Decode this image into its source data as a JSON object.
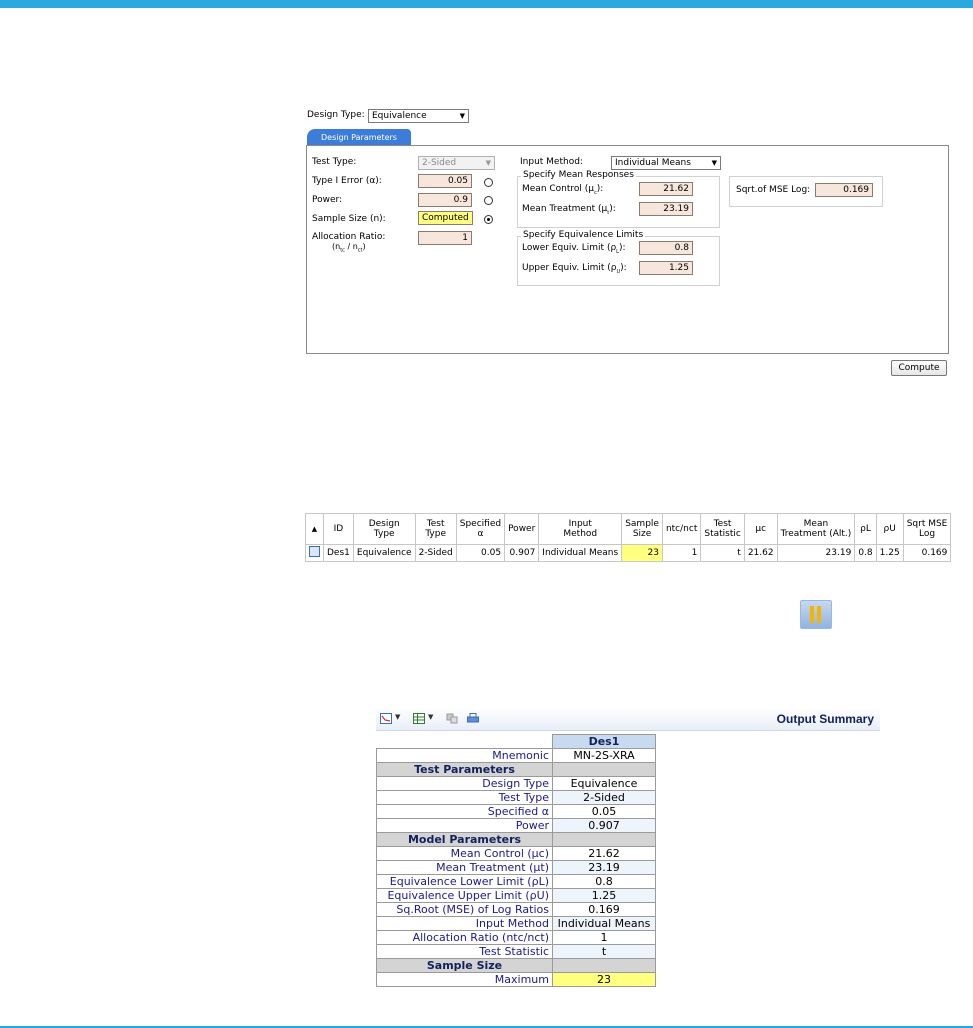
{
  "design": {
    "type_label": "Design Type:",
    "type_value": "Equivalence",
    "tab_label": "Design Parameters",
    "test_type_label": "Test Type:",
    "test_type_value": "2-Sided",
    "type1_label": "Type I Error (α):",
    "type1_value": "0.05",
    "power_label": "Power:",
    "power_value": "0.9",
    "sample_label": "Sample Size (n):",
    "sample_value": "Computed",
    "alloc_label": "Allocation Ratio:",
    "alloc_sub": "(n",
    "alloc_sub_tc": "tc",
    "alloc_sub_mid": " / n",
    "alloc_sub_ct": "ct",
    "alloc_sub_end": ")",
    "alloc_value": "1",
    "input_method_label": "Input Method:",
    "input_method_value": "Individual Means",
    "mean_group_title": "Specify Mean Responses",
    "mean_control_label": "Mean Control (μ",
    "mean_control_sub": "c",
    "mean_control_end": "):",
    "mean_control_value": "21.62",
    "mean_treatment_label": "Mean Treatment (μ",
    "mean_treatment_sub": "t",
    "mean_treatment_end": "):",
    "mean_treatment_value": "23.19",
    "equiv_group_title": "Specify Equivalence Limits",
    "lower_label": "Lower Equiv. Limit (ρ",
    "lower_sub": "L",
    "lower_end": "):",
    "lower_value": "0.8",
    "upper_label": "Upper Equiv. Limit (ρ",
    "upper_sub": "U",
    "upper_end": "):",
    "upper_value": "1.25",
    "sqrt_mse_label": "Sqrt.of MSE Log:",
    "sqrt_mse_value": "0.169",
    "compute_label": "Compute"
  },
  "grid": {
    "headers": [
      "ID",
      "Design\nType",
      "Test\nType",
      "Specified\nα",
      "Power",
      "Input\nMethod",
      "Sample\nSize",
      "ntc/nct",
      "Test\nStatistic",
      "μc",
      "Mean\nTreatment (Alt.)",
      "ρL",
      "ρU",
      "Sqrt MSE\nLog"
    ],
    "row": [
      "Des1",
      "Equivalence",
      "2-Sided",
      "0.05",
      "0.907",
      "Individual Means",
      "23",
      "1",
      "t",
      "21.62",
      "23.19",
      "0.8",
      "1.25",
      "0.169"
    ]
  },
  "output": {
    "title": "Output Summary",
    "column": "Des1",
    "rows": [
      {
        "k": "Mnemonic",
        "v": "MN-2S-XRA"
      },
      {
        "section": "Test Parameters"
      },
      {
        "k": "Design Type",
        "v": "Equivalence"
      },
      {
        "k": "Test Type",
        "v": "2-Sided"
      },
      {
        "k": "Specified α",
        "v": "0.05"
      },
      {
        "k": "Power",
        "v": "0.907"
      },
      {
        "section": "Model Parameters"
      },
      {
        "k": "Mean Control (μc)",
        "v": "21.62"
      },
      {
        "k": "Mean Treatment (μt)",
        "v": "23.19"
      },
      {
        "k": "Equivalence Lower Limit (ρL)",
        "v": "0.8"
      },
      {
        "k": "Equivalence Upper Limit (ρU)",
        "v": "1.25"
      },
      {
        "k": "Sq.Root (MSE) of Log Ratios",
        "v": "0.169"
      },
      {
        "k": "Input Method",
        "v": "Individual Means"
      },
      {
        "k": "Allocation Ratio (ntc/nct)",
        "v": "1"
      },
      {
        "k": "Test Statistic",
        "v": "t"
      },
      {
        "section": "Sample Size"
      },
      {
        "k": "Maximum",
        "v": "23"
      }
    ]
  }
}
